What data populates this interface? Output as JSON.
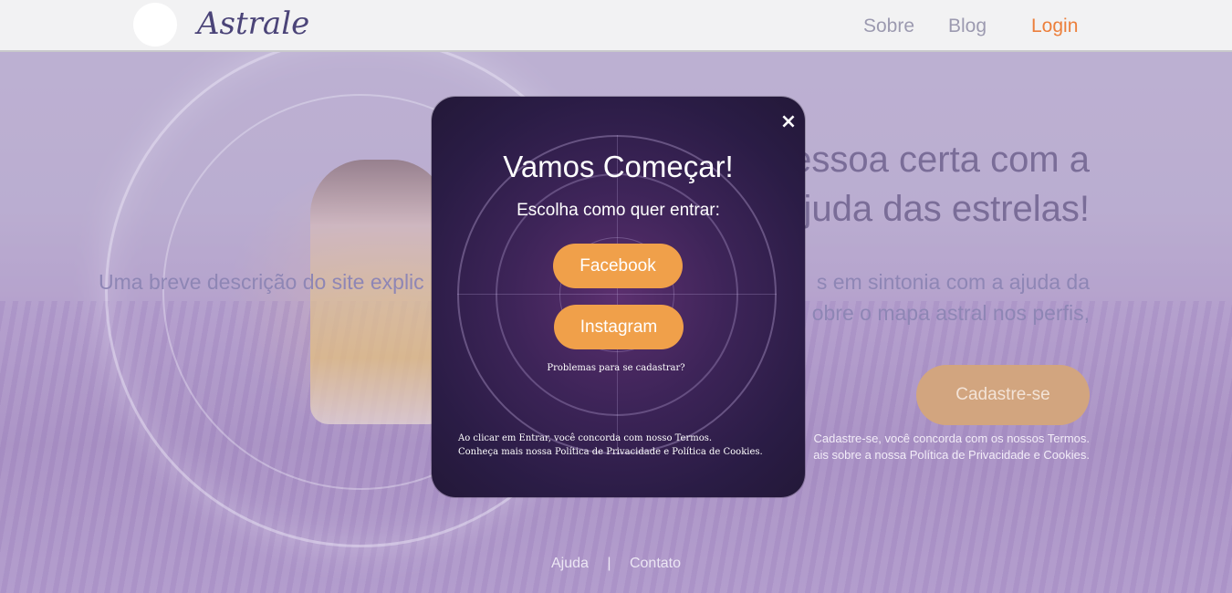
{
  "nav": {
    "brand": "Astrale",
    "links": {
      "about": "Sobre",
      "blog": "Blog",
      "login": "Login"
    }
  },
  "hero": {
    "title_line1": "essoa certa com a",
    "title_line2": "juda das estrelas!",
    "desc_left": "Uma breve descrição do site explic",
    "desc_right_line1": "s em sintonia com a ajuda da",
    "desc_right_line2": "obre o mapa astral nos perfis,",
    "cta_label": "Cadastre-se",
    "terms_line1": "Cadastre-se, você concorda com os nossos Termos.",
    "terms_line2": "ais sobre a nossa Política de Privacidade e Cookies."
  },
  "footer": {
    "help": "Ajuda",
    "separator": "|",
    "contact": "Contato"
  },
  "modal": {
    "close_icon": "×",
    "title": "Vamos Começar!",
    "subtitle": "Escolha como quer entrar:",
    "facebook_label": "Facebook",
    "instagram_label": "Instagram",
    "help_link": "Problemas para se cadastrar?",
    "terms_line1": "Ao clicar em Entrar, você concorda com nosso Termos.",
    "terms_line2": "Conheça mais nossa Política de Privacidade e Política de Cookies."
  },
  "colors": {
    "accent": "#ec7f3b",
    "button": "#f0a04a",
    "brand": "#4b4478",
    "modal_bg": "#2a1c45"
  }
}
